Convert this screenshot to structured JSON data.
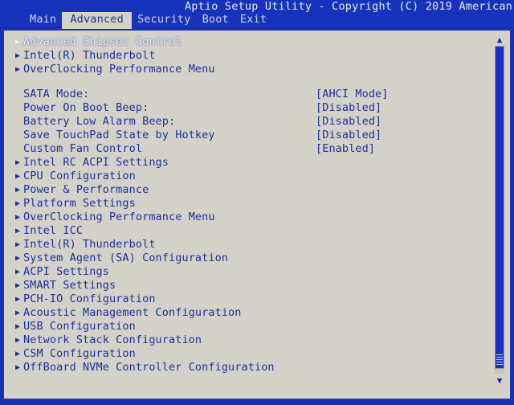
{
  "header": {
    "title": "Aptio Setup Utility - Copyright (C) 2019 American",
    "tabs": [
      {
        "label": "Main",
        "active": false
      },
      {
        "label": "Advanced",
        "active": true
      },
      {
        "label": "Security",
        "active": false
      },
      {
        "label": "Boot",
        "active": false
      },
      {
        "label": "Exit",
        "active": false
      }
    ]
  },
  "colors": {
    "background_blue": "#1530b8",
    "panel_gray": "#d4d2c8",
    "text_blue": "#1c2f9e",
    "selected_text": "#e9ecf5",
    "scrollbar_thumb": "#1c2fc8"
  },
  "menu": {
    "top_items": [
      {
        "arrow": "submenu-arrow",
        "label": "Advanced Chipset Control",
        "selected": true
      },
      {
        "arrow": "submenu-arrow",
        "label": "Intel(R) Thunderbolt",
        "selected": false
      },
      {
        "arrow": "submenu-arrow",
        "label": "OverClocking Performance Menu",
        "selected": false
      }
    ],
    "settings": [
      {
        "label": "SATA Mode:",
        "value": "[AHCI Mode]"
      },
      {
        "label": "Power On Boot Beep:",
        "value": "[Disabled]"
      },
      {
        "label": "Battery Low Alarm Beep:",
        "value": "[Disabled]"
      },
      {
        "label": "Save TouchPad State by Hotkey",
        "value": "[Disabled]"
      },
      {
        "label": "Custom Fan Control",
        "value": "[Enabled]"
      }
    ],
    "bottom_items": [
      {
        "arrow": "submenu-arrow",
        "label": "Intel RC ACPI Settings"
      },
      {
        "arrow": "submenu-arrow",
        "label": "CPU Configuration"
      },
      {
        "arrow": "submenu-arrow",
        "label": "Power & Performance"
      },
      {
        "arrow": "submenu-arrow",
        "label": "Platform Settings"
      },
      {
        "arrow": "submenu-arrow",
        "label": "OverClocking Performance Menu"
      },
      {
        "arrow": "submenu-arrow",
        "label": "Intel ICC"
      },
      {
        "arrow": "submenu-arrow",
        "label": "Intel(R) Thunderbolt"
      },
      {
        "arrow": "submenu-arrow",
        "label": "System Agent (SA) Configuration"
      },
      {
        "arrow": "submenu-arrow",
        "label": "ACPI Settings"
      },
      {
        "arrow": "submenu-arrow",
        "label": "SMART Settings"
      },
      {
        "arrow": "submenu-arrow",
        "label": "PCH-IO Configuration"
      },
      {
        "arrow": "submenu-arrow",
        "label": "Acoustic Management Configuration"
      },
      {
        "arrow": "submenu-arrow",
        "label": "USB Configuration"
      },
      {
        "arrow": "submenu-arrow",
        "label": "Network Stack Configuration"
      },
      {
        "arrow": "submenu-arrow",
        "label": "CSM Configuration"
      },
      {
        "arrow": "submenu-arrow",
        "label": "OffBoard NVMe Controller Configuration"
      }
    ]
  },
  "scrollbar": {
    "up_glyph": "▲",
    "down_glyph": "▼",
    "arrow_glyph": "▶"
  }
}
